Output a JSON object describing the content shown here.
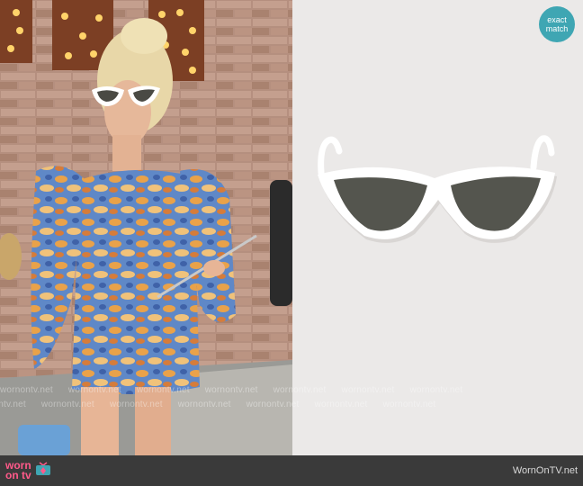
{
  "badge": {
    "line1": "exact",
    "line2": "match"
  },
  "watermark": {
    "text": "wornontv.net"
  },
  "footer": {
    "logo_top": "worn",
    "logo_bottom": "on tv",
    "site_name": "WornOnTV.net"
  },
  "colors": {
    "badge": "#3fa6b3",
    "logo": "#ff5a8a",
    "footer_bg": "#3a3a3a"
  },
  "icons": {
    "logo": "tv-icon"
  }
}
